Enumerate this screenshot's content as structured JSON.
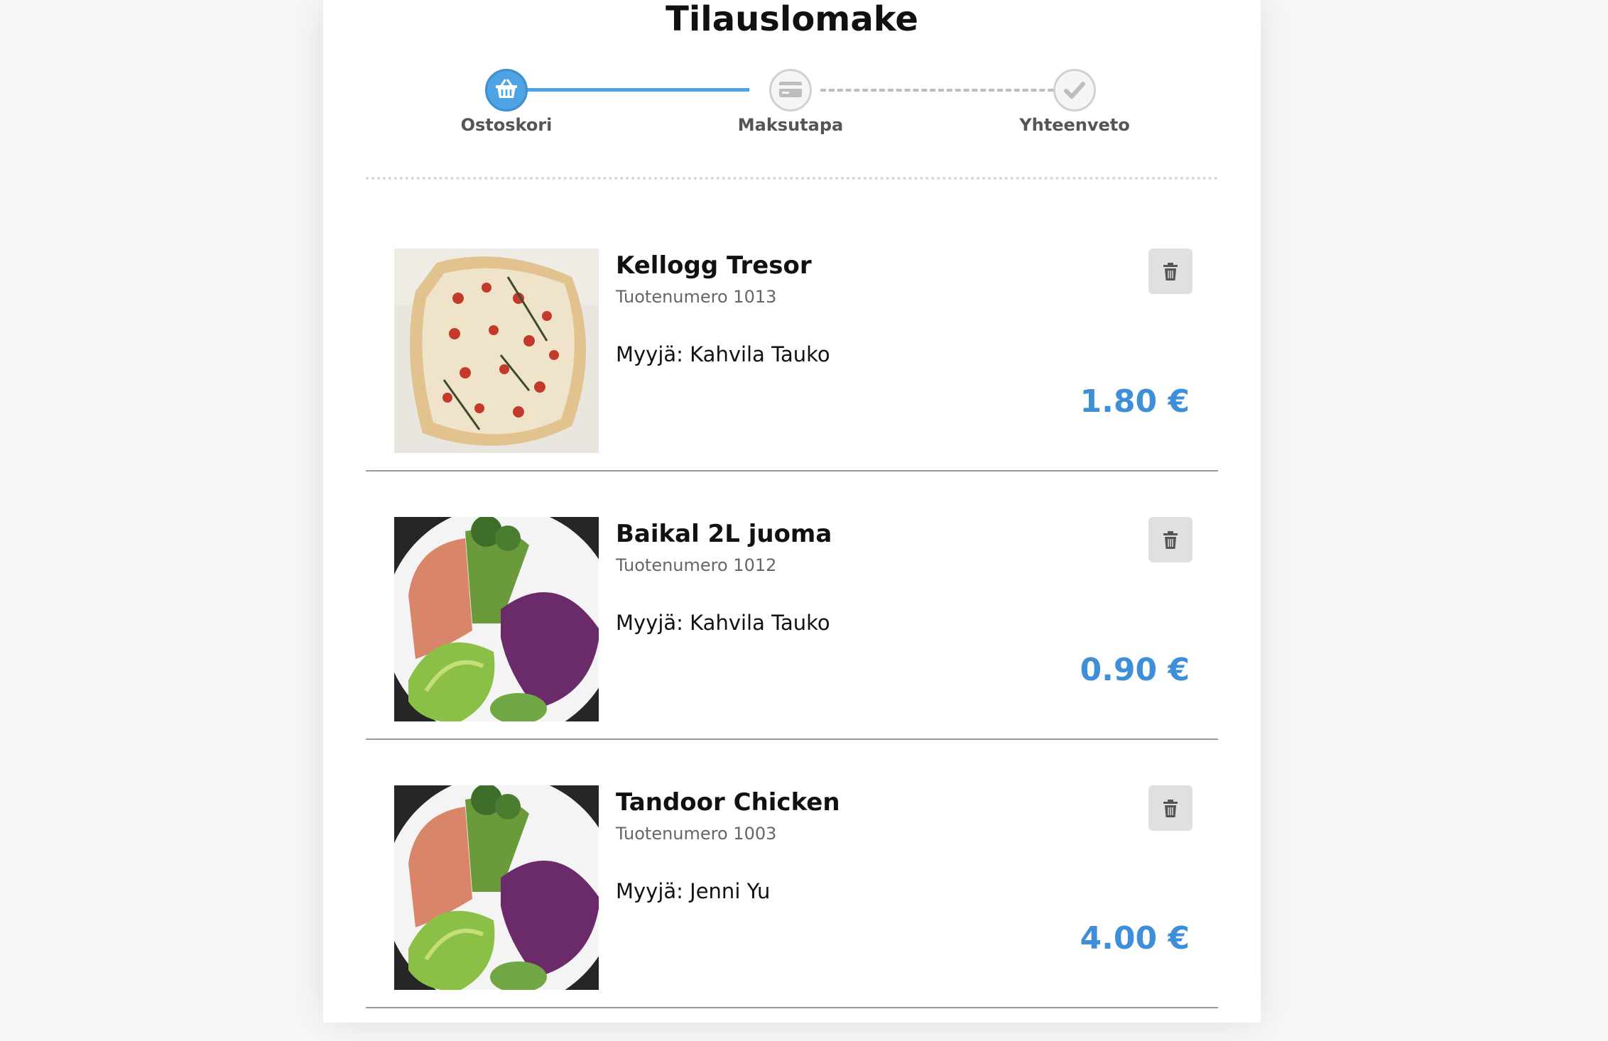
{
  "page": {
    "title": "Tilauslomake"
  },
  "steps": [
    {
      "label": "Ostoskori",
      "icon": "basket-icon",
      "state": "active"
    },
    {
      "label": "Maksutapa",
      "icon": "credit-card-icon",
      "state": "inactive"
    },
    {
      "label": "Yhteenveto",
      "icon": "checkmark-icon",
      "state": "inactive"
    }
  ],
  "items": [
    {
      "name": "Kellogg Tresor",
      "sku": "Tuotenumero 1013",
      "seller": "Myyjä: Kahvila Tauko",
      "price": "1.80 €",
      "image": "focaccia-photo"
    },
    {
      "name": "Baikal 2L juoma",
      "sku": "Tuotenumero 1012",
      "seller": "Myyjä: Kahvila Tauko",
      "price": "0.90 €",
      "image": "salad-bowl-photo"
    },
    {
      "name": "Tandoor Chicken",
      "sku": "Tuotenumero 1003",
      "seller": "Myyjä: Jenni Yu",
      "price": "4.00 €",
      "image": "salad-bowl-photo"
    }
  ],
  "colors": {
    "accent": "#4da3e3",
    "price": "#3f8fd8",
    "delete_button": "#e0e0e0"
  }
}
